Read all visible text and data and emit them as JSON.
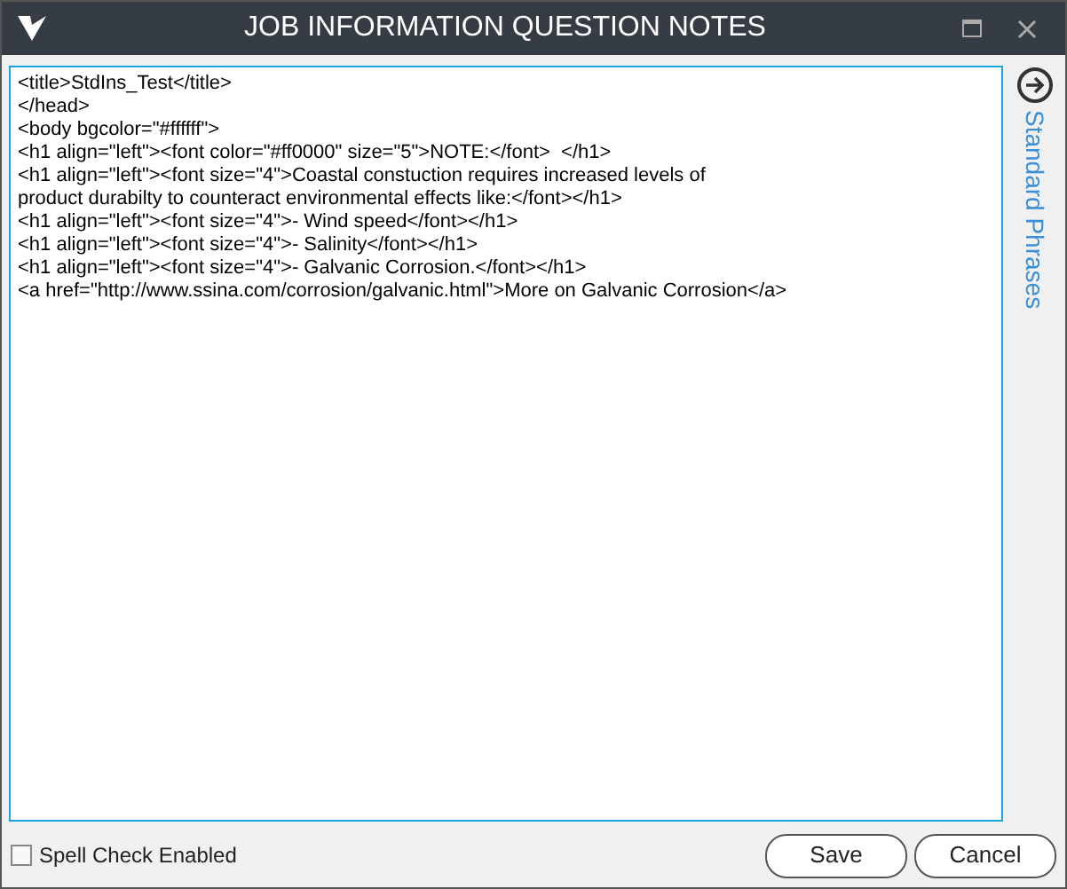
{
  "window": {
    "title": "JOB INFORMATION QUESTION NOTES"
  },
  "editor": {
    "lines": [
      "<title>StdIns_Test</title>",
      "</head>",
      "<body bgcolor=\"#ffffff\">",
      "<h1 align=\"left\"><font color=\"#ff0000\" size=\"5\">NOTE:</font>  </h1>",
      "<h1 align=\"left\"><font size=\"4\">Coastal constuction requires increased levels of",
      "product durabilty to counteract environmental effects like:</font></h1>",
      "<h1 align=\"left\"><font size=\"4\">- Wind speed</font></h1>",
      "<h1 align=\"left\"><font size=\"4\">- Salinity</font></h1>",
      "<h1 align=\"left\"><font size=\"4\">- Galvanic Corrosion.</font></h1>",
      "<a href=\"http://www.ssina.com/corrosion/galvanic.html\">More on Galvanic Corrosion</a>"
    ]
  },
  "side_panel": {
    "label": "Standard Phrases"
  },
  "spell_check": {
    "label": "Spell Check Enabled",
    "checked": false
  },
  "buttons": [
    "Save",
    "Cancel"
  ]
}
